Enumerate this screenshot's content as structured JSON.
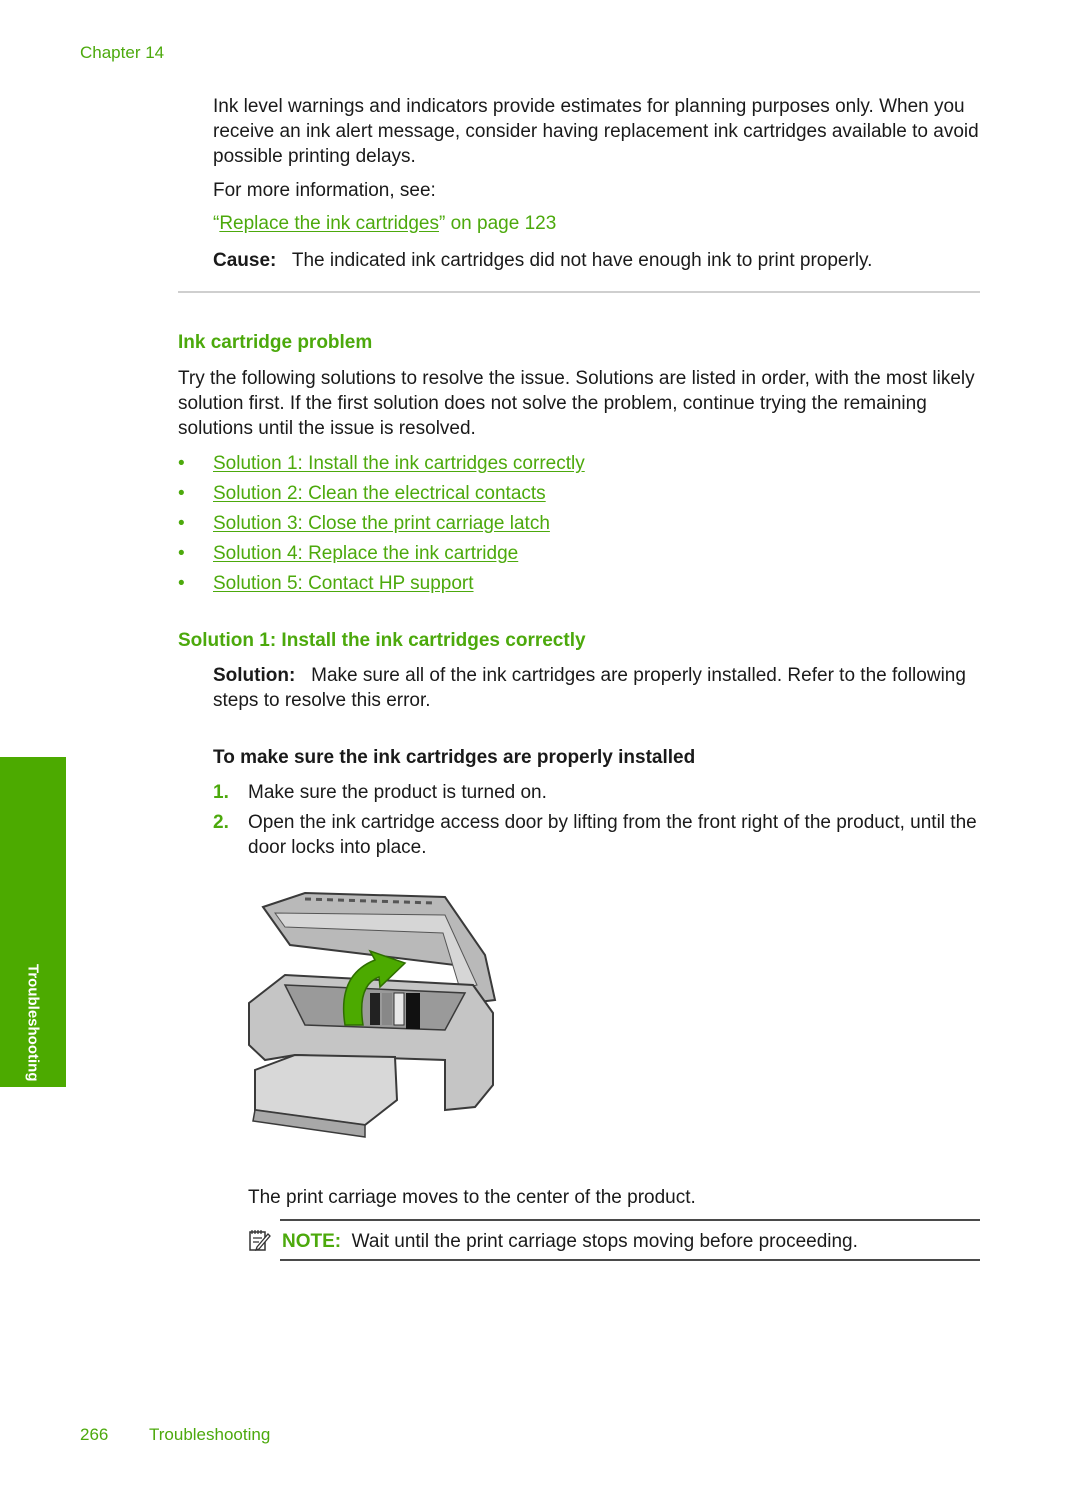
{
  "header": {
    "chapter": "Chapter 14"
  },
  "intro": {
    "paragraph": "Ink level warnings and indicators provide estimates for planning purposes only. When you receive an ink alert message, consider having replacement ink cartridges available to avoid possible printing delays.",
    "more_info": "For more information, see:",
    "xref_open_quote": "“",
    "xref_link": "Replace the ink cartridges",
    "xref_close": "” on page 123",
    "cause_label": "Cause:",
    "cause_text": "The indicated ink cartridges did not have enough ink to print properly."
  },
  "section": {
    "title": "Ink cartridge problem",
    "paragraph": "Try the following solutions to resolve the issue. Solutions are listed in order, with the most likely solution first. If the first solution does not solve the problem, continue trying the remaining solutions until the issue is resolved.",
    "bullet_glyph": "•",
    "solutions": [
      "Solution 1: Install the ink cartridges correctly",
      "Solution 2: Clean the electrical contacts",
      "Solution 3: Close the print carriage latch",
      "Solution 4: Replace the ink cartridge",
      "Solution 5: Contact HP support"
    ]
  },
  "solution1": {
    "title": "Solution 1: Install the ink cartridges correctly",
    "label": "Solution:",
    "text": "Make sure all of the ink cartridges are properly installed. Refer to the following steps to resolve this error.",
    "procedure_title": "To make sure the ink cartridges are properly installed",
    "steps": [
      {
        "num": "1.",
        "text": "Make sure the product is turned on."
      },
      {
        "num": "2.",
        "text": "Open the ink cartridge access door by lifting from the front right of the product, until the door locks into place."
      }
    ],
    "after_figure": "The print carriage moves to the center of the product.",
    "note_icon": "note-pencil-icon",
    "note_label": "NOTE:",
    "note_text": "Wait until the print carriage stops moving before proceeding."
  },
  "side_tab": {
    "label": "Troubleshooting",
    "color": "#4caa00"
  },
  "footer": {
    "page_number": "266",
    "section": "Troubleshooting"
  },
  "colors": {
    "accent": "#4ca90c",
    "text": "#1a1a1a"
  }
}
